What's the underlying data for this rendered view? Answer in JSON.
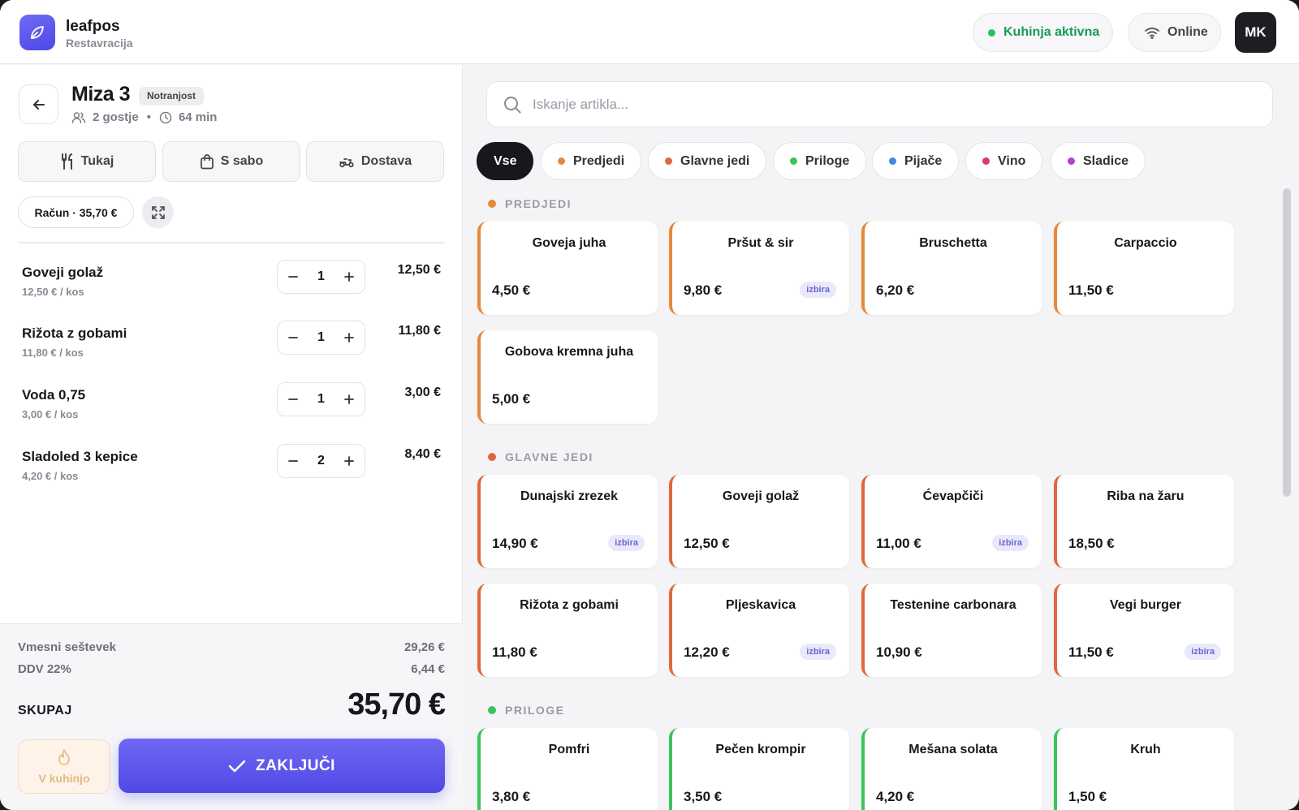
{
  "header": {
    "brand_name": "leafpos",
    "brand_sub": "Restavracija",
    "kitchen_status": "Kuhinja aktivna",
    "connection": "Online",
    "user_initials": "MK"
  },
  "table": {
    "title": "Miza 3",
    "area": "Notranjost",
    "guests": "2 gostje",
    "separator": "•",
    "duration": "64 min"
  },
  "modes": [
    {
      "label": "Tukaj",
      "active": true
    },
    {
      "label": "S sabo",
      "active": false
    },
    {
      "label": "Dostava",
      "active": false
    }
  ],
  "bill": {
    "label": "Račun · 35,70 €"
  },
  "order": [
    {
      "name": "Goveji golaž",
      "unit": "12,50 € / kos",
      "qty": "1",
      "total": "12,50 €"
    },
    {
      "name": "Rižota z gobami",
      "unit": "11,80 € / kos",
      "qty": "1",
      "total": "11,80 €"
    },
    {
      "name": "Voda 0,75",
      "unit": "3,00 € / kos",
      "qty": "1",
      "total": "3,00 €"
    },
    {
      "name": "Sladoled 3 kepice",
      "unit": "4,20 € / kos",
      "qty": "2",
      "total": "8,40 €"
    }
  ],
  "summary": {
    "subtotal_label": "Vmesni seštevek",
    "subtotal": "29,26 €",
    "vat_label": "DDV 22%",
    "vat": "6,44 €",
    "total_label": "SKUPAJ",
    "total": "35,70 €"
  },
  "actions": {
    "kitchen_label": "V kuhinjo",
    "finish_label": "ZAKLJUČI"
  },
  "search": {
    "placeholder": "Iskanje artikla..."
  },
  "categories": [
    {
      "label": "Vse",
      "color": null,
      "active": true
    },
    {
      "label": "Predjedi",
      "color": "#e8883a",
      "active": false
    },
    {
      "label": "Glavne jedi",
      "color": "#e0683e",
      "active": false
    },
    {
      "label": "Priloge",
      "color": "#3cc45a",
      "active": false
    },
    {
      "label": "Pijače",
      "color": "#3b8be0",
      "active": false
    },
    {
      "label": "Vino",
      "color": "#d63a6a",
      "active": false
    },
    {
      "label": "Sladice",
      "color": "#b040d8",
      "active": false
    }
  ],
  "sections": [
    {
      "title": "PREDJEDI",
      "color": "#e8883a",
      "items": [
        {
          "name": "Goveja juha",
          "price": "4,50 €",
          "tag": ""
        },
        {
          "name": "Pršut & sir",
          "price": "9,80 €",
          "tag": "izbira"
        },
        {
          "name": "Bruschetta",
          "price": "6,20 €",
          "tag": ""
        },
        {
          "name": "Carpaccio",
          "price": "11,50 €",
          "tag": ""
        },
        {
          "name": "Gobova kremna juha",
          "price": "5,00 €",
          "tag": ""
        }
      ]
    },
    {
      "title": "GLAVNE JEDI",
      "color": "#e0683e",
      "items": [
        {
          "name": "Dunajski zrezek",
          "price": "14,90 €",
          "tag": "izbira"
        },
        {
          "name": "Goveji golaž",
          "price": "12,50 €",
          "tag": ""
        },
        {
          "name": "Ćevapčiči",
          "price": "11,00 €",
          "tag": "izbira"
        },
        {
          "name": "Riba na žaru",
          "price": "18,50 €",
          "tag": ""
        },
        {
          "name": "Rižota z gobami",
          "price": "11,80 €",
          "tag": ""
        },
        {
          "name": "Pljeskavica",
          "price": "12,20 €",
          "tag": "izbira"
        },
        {
          "name": "Testenine carbonara",
          "price": "10,90 €",
          "tag": ""
        },
        {
          "name": "Vegi burger",
          "price": "11,50 €",
          "tag": "izbira"
        }
      ]
    },
    {
      "title": "PRILOGE",
      "color": "#3cc45a",
      "items": [
        {
          "name": "Pomfri",
          "price": "3,80 €",
          "tag": ""
        },
        {
          "name": "Pečen krompir",
          "price": "3,50 €",
          "tag": ""
        },
        {
          "name": "Mešana solata",
          "price": "4,20 €",
          "tag": ""
        },
        {
          "name": "Kruh",
          "price": "1,50 €",
          "tag": ""
        }
      ]
    }
  ]
}
